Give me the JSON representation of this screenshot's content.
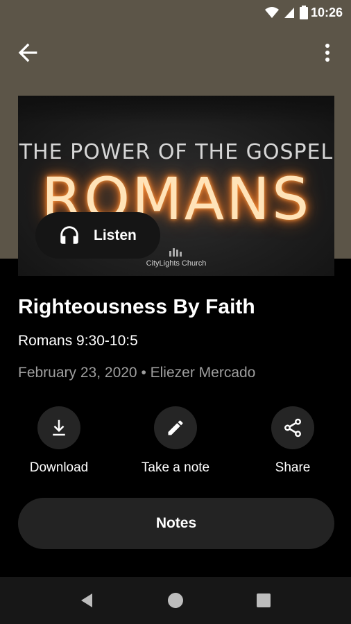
{
  "status_bar": {
    "time": "10:26"
  },
  "artwork": {
    "subtitle": "THE POWER OF THE GOSPEL",
    "title": "ROMANS",
    "church": "CityLights Church"
  },
  "listen_button": {
    "label": "Listen"
  },
  "sermon": {
    "title": "Righteousness By Faith",
    "scripture": "Romans 9:30-10:5",
    "meta": "February 23, 2020 • Eliezer Mercado"
  },
  "actions": [
    {
      "label": "Download",
      "icon": "download-icon"
    },
    {
      "label": "Take a note",
      "icon": "pencil-icon"
    },
    {
      "label": "Share",
      "icon": "share-icon"
    }
  ],
  "notes_button": {
    "label": "Notes"
  },
  "colors": {
    "header_bg": "#5c5548",
    "background": "#000000",
    "button_bg": "#252525",
    "muted_text": "#9e9e9e",
    "neon": "#ffe3b8"
  },
  "nav_bar": {
    "icons": [
      "back-triangle-icon",
      "home-circle-icon",
      "recents-square-icon"
    ]
  }
}
